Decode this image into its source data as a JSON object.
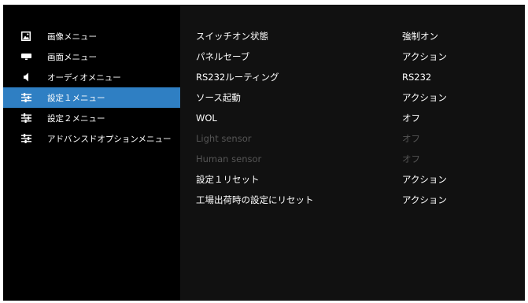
{
  "colors": {
    "background": "#000000",
    "panel": "#111111",
    "selected": "#2f7fc3",
    "text": "#ffffff",
    "disabled": "#555555"
  },
  "sidebar": {
    "items": [
      {
        "label": "画像メニュー",
        "icon": "picture-icon",
        "selected": false
      },
      {
        "label": "画面メニュー",
        "icon": "monitor-icon",
        "selected": false
      },
      {
        "label": "オーディオメニュー",
        "icon": "speaker-icon",
        "selected": false
      },
      {
        "label": "設定１メニュー",
        "icon": "sliders-icon",
        "selected": true
      },
      {
        "label": "設定２メニュー",
        "icon": "sliders-icon",
        "selected": false
      },
      {
        "label": "アドバンスドオプションメニュー",
        "icon": "sliders-icon",
        "selected": false
      }
    ]
  },
  "settings": {
    "rows": [
      {
        "name": "スイッチオン状態",
        "value": "強制オン",
        "enabled": true
      },
      {
        "name": "パネルセーブ",
        "value": "アクション",
        "enabled": true
      },
      {
        "name": "RS232ルーティング",
        "value": "RS232",
        "enabled": true
      },
      {
        "name": "ソース起動",
        "value": "アクション",
        "enabled": true
      },
      {
        "name": "WOL",
        "value": "オフ",
        "enabled": true
      },
      {
        "name": "Light sensor",
        "value": "オフ",
        "enabled": false
      },
      {
        "name": "Human sensor",
        "value": "オフ",
        "enabled": false
      },
      {
        "name": "設定１リセット",
        "value": "アクション",
        "enabled": true
      },
      {
        "name": "工場出荷時の設定にリセット",
        "value": "アクション",
        "enabled": true
      }
    ]
  }
}
